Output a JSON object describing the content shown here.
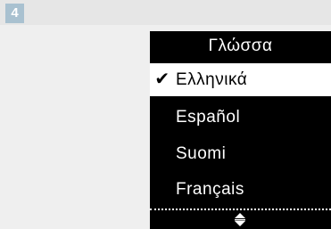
{
  "step": {
    "number": "4"
  },
  "screen": {
    "title": "Γλώσσα",
    "items": [
      {
        "label": "Ελληνικά",
        "selected": true
      },
      {
        "label": "Español",
        "selected": false
      },
      {
        "label": "Suomi",
        "selected": false
      },
      {
        "label": "Français",
        "selected": false
      }
    ],
    "selected_marker": "✔",
    "scroll_icon": "up-down-arrows-icon"
  },
  "colors": {
    "screen_bg": "#000000",
    "selection_bg": "#ffffff",
    "badge": "#a9c1d0",
    "panel": "#efefef",
    "header": "#e6e6e6"
  }
}
